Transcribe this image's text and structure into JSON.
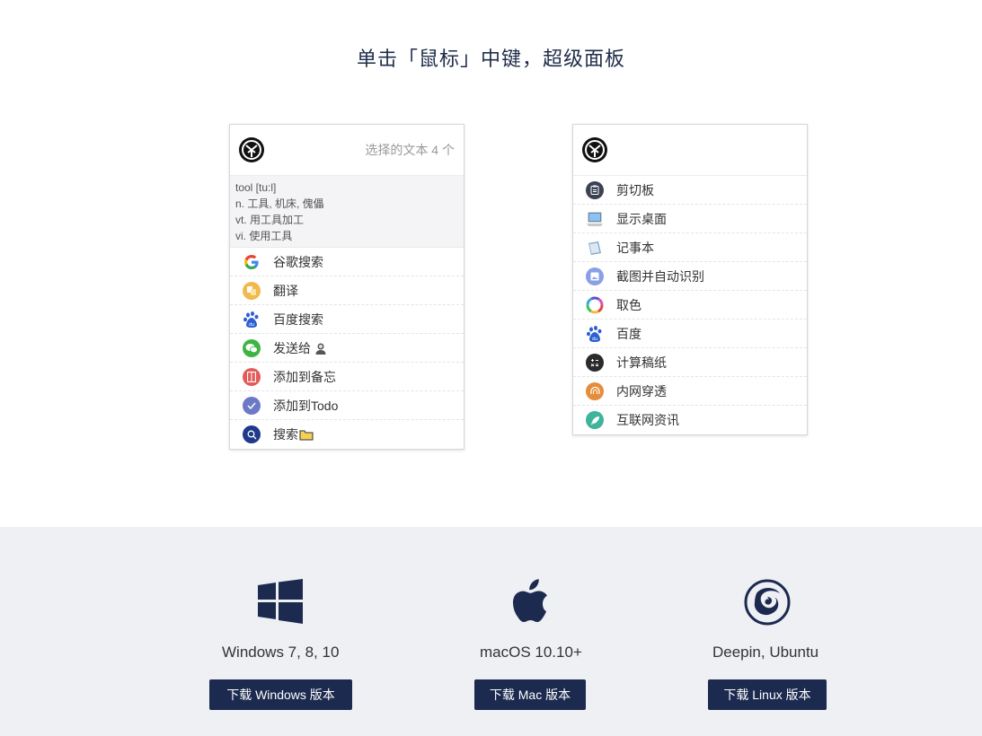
{
  "headline": "单击「鼠标」中键，超级面板",
  "left_panel": {
    "selection_count": "选择的文本 4 个",
    "dictionary": {
      "word": "tool [tu:l]",
      "noun": "n. 工具, 机床, 傀儡",
      "verb_t": "vt. 用工具加工",
      "verb_i": "vi. 使用工具"
    },
    "items": [
      {
        "label": "谷歌搜索",
        "icon": "google-icon",
        "color": "#4285f4"
      },
      {
        "label": "翻译",
        "icon": "translate-icon",
        "color": "#f2b84b"
      },
      {
        "label": "百度搜索",
        "icon": "baidu-paw-icon",
        "color": "#2d5fd3"
      },
      {
        "label": "发送给",
        "icon": "wechat-icon",
        "color": "#3eb442",
        "suffix_icon": "contact-avatar-icon"
      },
      {
        "label": "添加到备忘",
        "icon": "memo-icon",
        "color": "#e35d58"
      },
      {
        "label": "添加到Todo",
        "icon": "todo-check-icon",
        "color": "#6c79c6"
      },
      {
        "label": "搜索",
        "icon": "search-icon",
        "color": "#1f3a8a",
        "suffix_icon": "folder-icon"
      }
    ]
  },
  "right_panel": {
    "items": [
      {
        "label": "剪切板",
        "icon": "clipboard-icon",
        "color": "#3c4153"
      },
      {
        "label": "显示桌面",
        "icon": "desktop-icon",
        "color": "#4a8fd6"
      },
      {
        "label": "记事本",
        "icon": "notepad-icon",
        "color": "#7fa6c9"
      },
      {
        "label": "截图并自动识别",
        "icon": "screenshot-icon",
        "color": "#8aa0e6"
      },
      {
        "label": "取色",
        "icon": "color-picker-icon",
        "color": "#e0483f"
      },
      {
        "label": "百度",
        "icon": "baidu-paw-icon",
        "color": "#2d5fd3"
      },
      {
        "label": "计算稿纸",
        "icon": "calculator-icon",
        "color": "#2b2b2b"
      },
      {
        "label": "内网穿透",
        "icon": "tunnel-icon",
        "color": "#e58d3b"
      },
      {
        "label": "互联网资讯",
        "icon": "rocket-icon",
        "color": "#3fb39b"
      }
    ]
  },
  "downloads": [
    {
      "os": "Windows 7, 8, 10",
      "icon": "windows-icon",
      "button": "下载 Windows 版本"
    },
    {
      "os": "macOS 10.10+",
      "icon": "apple-icon",
      "button": "下载 Mac 版本"
    },
    {
      "os": "Deepin, Ubuntu",
      "icon": "deepin-icon",
      "button": "下载 Linux 版本"
    }
  ],
  "brand_color": "#1c2a4f"
}
